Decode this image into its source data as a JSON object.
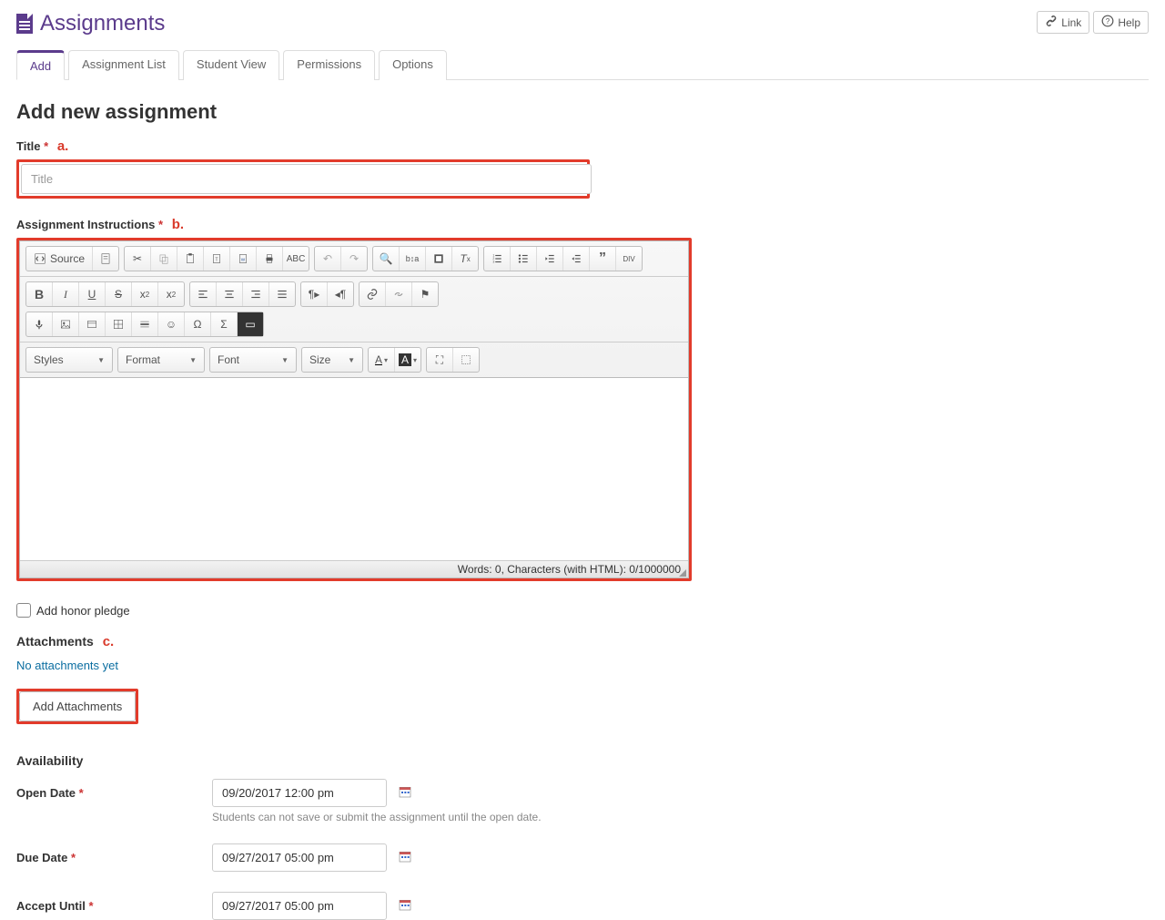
{
  "header": {
    "title": "Assignments",
    "link_label": "Link",
    "help_label": "Help"
  },
  "tabs": [
    {
      "id": "add",
      "label": "Add",
      "active": true
    },
    {
      "id": "list",
      "label": "Assignment List",
      "active": false
    },
    {
      "id": "student",
      "label": "Student View",
      "active": false
    },
    {
      "id": "perm",
      "label": "Permissions",
      "active": false
    },
    {
      "id": "opt",
      "label": "Options",
      "active": false
    }
  ],
  "form": {
    "heading": "Add new assignment",
    "title": {
      "label": "Title",
      "placeholder": "Title",
      "value": "",
      "annotation": "a."
    },
    "instructions": {
      "label": "Assignment Instructions",
      "annotation": "b."
    },
    "editor": {
      "source_label": "Source",
      "dropdowns": {
        "styles": "Styles",
        "format": "Format",
        "font": "Font",
        "size": "Size"
      },
      "status": "Words: 0, Characters (with HTML): 0/1000000"
    },
    "honor_pledge": {
      "checked": false,
      "label": "Add honor pledge"
    },
    "attachments": {
      "heading": "Attachments",
      "annotation": "c.",
      "status": "No attachments yet",
      "button": "Add Attachments"
    },
    "availability": {
      "heading": "Availability",
      "open_date": {
        "label": "Open Date",
        "value": "09/20/2017 12:00 pm",
        "hint": "Students can not save or submit the assignment until the open date."
      },
      "due_date": {
        "label": "Due Date",
        "value": "09/27/2017 05:00 pm"
      },
      "accept_until": {
        "label": "Accept Until",
        "value": "09/27/2017 05:00 pm"
      }
    }
  }
}
